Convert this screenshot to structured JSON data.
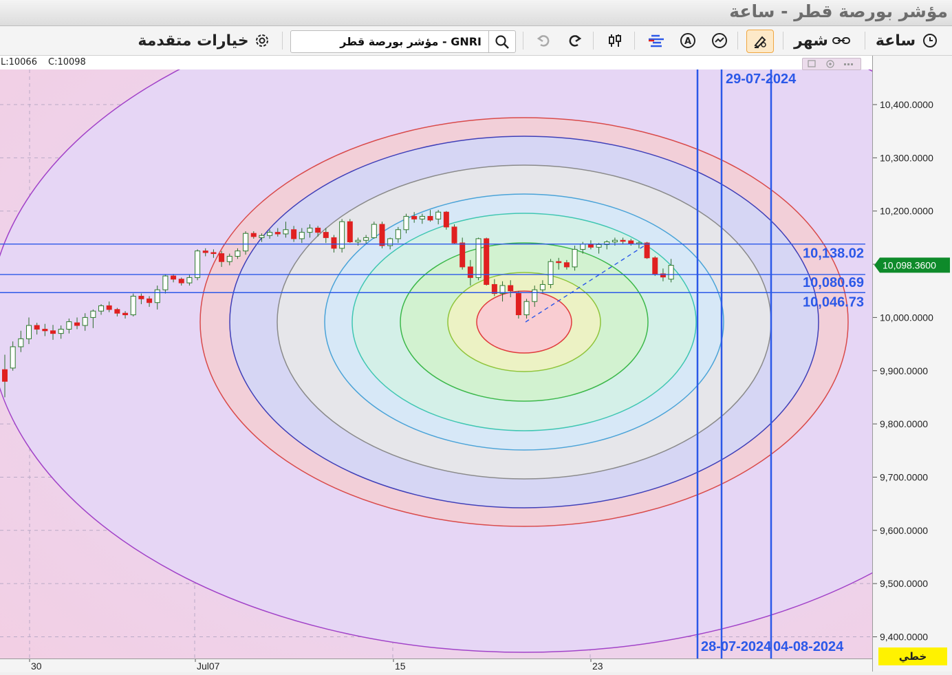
{
  "window": {
    "title": "مؤشر بورصة قطر - ساعة"
  },
  "toolbar": {
    "interval_label": "ساعة",
    "period_label": "شهر",
    "advanced_options_label": "خيارات متقدمة",
    "symbol_value": "GNRI - مؤشر بورصة قطر",
    "icons": [
      "clock-icon",
      "link-icon",
      "draw-tool-icon",
      "indicator-icon",
      "auto-icon",
      "histogram-icon",
      "compare-icon",
      "redo-icon",
      "undo-icon",
      "search-icon",
      "settings-icon"
    ]
  },
  "ohlc": {
    "low": "L:10066",
    "close": "C:10098"
  },
  "chart_data": {
    "type": "candlestick",
    "title": "",
    "y_axis": {
      "min": 9370,
      "max": 10470,
      "ticks": [
        "10,400.0000",
        "10,300.0000",
        "10,200.0000",
        "10,100.0000",
        "10,000.0000",
        "9,900.0000",
        "9,800.0000",
        "9,700.0000",
        "9,600.0000",
        "9,500.0000",
        "9,400.0000"
      ]
    },
    "x_axis": {
      "labels": [
        "30",
        "Jul07",
        "15",
        "23"
      ]
    },
    "last_price": "10,098.3600",
    "horizontal_lines": [
      {
        "value": 10138.02,
        "label": "10,138.02"
      },
      {
        "value": 10080.69,
        "label": "10,080.69"
      },
      {
        "value": 10046.73,
        "label": "10,046.73"
      }
    ],
    "date_lines": [
      "29-07-2024",
      "28-07-2024",
      "04-08-2024"
    ],
    "candles": [
      [
        9902,
        9930,
        9850,
        9880
      ],
      [
        9905,
        9955,
        9900,
        9945
      ],
      [
        9945,
        9975,
        9935,
        9960
      ],
      [
        9960,
        10000,
        9950,
        9985
      ],
      [
        9985,
        9990,
        9968,
        9978
      ],
      [
        9978,
        9988,
        9965,
        9975
      ],
      [
        9975,
        9986,
        9958,
        9970
      ],
      [
        9970,
        9985,
        9960,
        9978
      ],
      [
        9978,
        9998,
        9970,
        9992
      ],
      [
        9990,
        10000,
        9978,
        9985
      ],
      [
        9985,
        10008,
        9975,
        10000
      ],
      [
        10000,
        10015,
        9980,
        10012
      ],
      [
        10012,
        10025,
        10005,
        10022
      ],
      [
        10022,
        10030,
        10010,
        10015
      ],
      [
        10015,
        10018,
        10002,
        10008
      ],
      [
        10008,
        10012,
        9998,
        10005
      ],
      [
        10005,
        10045,
        10002,
        10040
      ],
      [
        10040,
        10045,
        10025,
        10035
      ],
      [
        10035,
        10040,
        10020,
        10028
      ],
      [
        10028,
        10060,
        10015,
        10052
      ],
      [
        10052,
        10080,
        10045,
        10078
      ],
      [
        10078,
        10082,
        10066,
        10072
      ],
      [
        10072,
        10075,
        10060,
        10065
      ],
      [
        10065,
        10080,
        10060,
        10075
      ],
      [
        10075,
        10128,
        10070,
        10125
      ],
      [
        10125,
        10130,
        10115,
        10122
      ],
      [
        10122,
        10128,
        10112,
        10120
      ],
      [
        10120,
        10125,
        10095,
        10105
      ],
      [
        10105,
        10120,
        10098,
        10115
      ],
      [
        10115,
        10130,
        10110,
        10125
      ],
      [
        10125,
        10162,
        10118,
        10158
      ],
      [
        10158,
        10162,
        10148,
        10152
      ],
      [
        10150,
        10158,
        10142,
        10154
      ],
      [
        10154,
        10165,
        10148,
        10160
      ],
      [
        10160,
        10168,
        10152,
        10157
      ],
      [
        10157,
        10180,
        10150,
        10165
      ],
      [
        10165,
        10172,
        10142,
        10148
      ],
      [
        10148,
        10168,
        10140,
        10160
      ],
      [
        10160,
        10175,
        10150,
        10168
      ],
      [
        10168,
        10172,
        10152,
        10160
      ],
      [
        10160,
        10168,
        10140,
        10150
      ],
      [
        10150,
        10155,
        10122,
        10130
      ],
      [
        10130,
        10185,
        10122,
        10180
      ],
      [
        10180,
        10185,
        10140,
        10142
      ],
      [
        10142,
        10150,
        10135,
        10145
      ],
      [
        10145,
        10155,
        10138,
        10150
      ],
      [
        10150,
        10180,
        10148,
        10175
      ],
      [
        10175,
        10180,
        10130,
        10135
      ],
      [
        10135,
        10150,
        10128,
        10148
      ],
      [
        10148,
        10170,
        10140,
        10165
      ],
      [
        10165,
        10195,
        10158,
        10190
      ],
      [
        10190,
        10198,
        10178,
        10185
      ],
      [
        10185,
        10195,
        10176,
        10190
      ],
      [
        10190,
        10202,
        10180,
        10183
      ],
      [
        10185,
        10202,
        10175,
        10198
      ],
      [
        10198,
        10200,
        10165,
        10170
      ],
      [
        10170,
        10175,
        10138,
        10140
      ],
      [
        10140,
        10150,
        10090,
        10095
      ],
      [
        10095,
        10108,
        10060,
        10075
      ],
      [
        10075,
        10150,
        10070,
        10148
      ],
      [
        10148,
        10150,
        10060,
        10062
      ],
      [
        10062,
        10072,
        10040,
        10045
      ],
      [
        10045,
        10068,
        10030,
        10060
      ],
      [
        10060,
        10070,
        10038,
        10050
      ],
      [
        10045,
        10050,
        9998,
        10005
      ],
      [
        10005,
        10035,
        9998,
        10030
      ],
      [
        10030,
        10060,
        10020,
        10052
      ],
      [
        10052,
        10070,
        10045,
        10062
      ],
      [
        10062,
        10110,
        10055,
        10105
      ],
      [
        10105,
        10112,
        10090,
        10103
      ],
      [
        10103,
        10108,
        10090,
        10095
      ],
      [
        10095,
        10135,
        10088,
        10128
      ],
      [
        10128,
        10142,
        10120,
        10138
      ],
      [
        10138,
        10145,
        10128,
        10132
      ],
      [
        10132,
        10140,
        10120,
        10137
      ],
      [
        10137,
        10145,
        10128,
        10142
      ],
      [
        10142,
        10150,
        10135,
        10145
      ],
      [
        10145,
        10150,
        10137,
        10144
      ],
      [
        10144,
        10148,
        10135,
        10139
      ],
      [
        10139,
        10143,
        10130,
        10140
      ],
      [
        10140,
        10142,
        10110,
        10112
      ],
      [
        10112,
        10115,
        10078,
        10082
      ],
      [
        10082,
        10092,
        10068,
        10076
      ],
      [
        10072,
        10110,
        10066,
        10098
      ]
    ]
  },
  "footer": {
    "draw_mode_label": "خطي"
  },
  "colors": {
    "up": "#2c7a2c",
    "down": "#e02020",
    "hline": "#2b58e8",
    "vline": "#2b58e8",
    "price_tag": "#0e8a2a",
    "draw_badge": "#fff200"
  }
}
